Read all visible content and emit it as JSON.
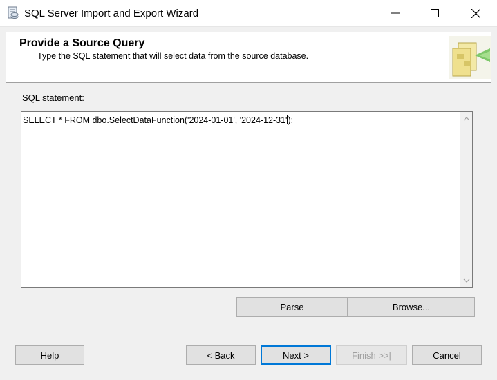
{
  "window": {
    "title": "SQL Server Import and Export Wizard",
    "controls": [
      "minimize",
      "maximize",
      "close"
    ]
  },
  "header": {
    "title": "Provide a Source Query",
    "subtitle": "Type the SQL statement that will select data from the source database."
  },
  "sql": {
    "label": "SQL statement:",
    "text_before_caret": "SELECT * FROM dbo.SelectDataFunction('2024-01-01', '2024-12-31'",
    "text_after_caret": ");"
  },
  "buttons": {
    "parse": "Parse",
    "browse": "Browse...",
    "help": "Help",
    "back": "< Back",
    "next": "Next >",
    "finish": "Finish >>|",
    "cancel": "Cancel"
  },
  "colors": {
    "default_button_border": "#0078d7",
    "disabled_text": "#a0a0a0"
  }
}
